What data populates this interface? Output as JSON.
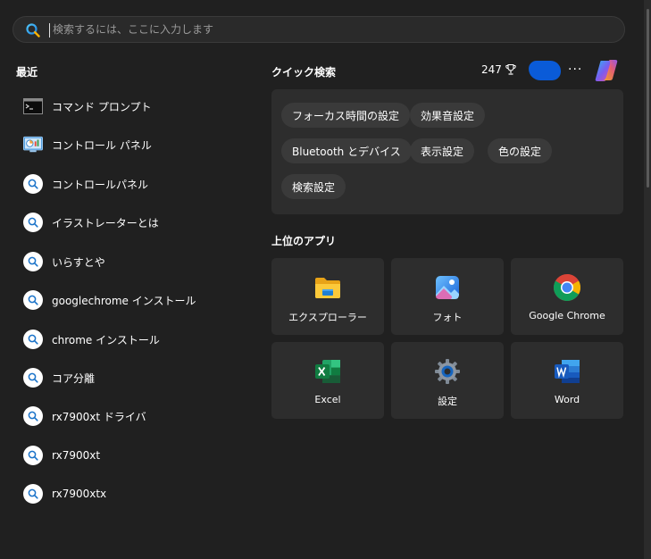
{
  "search": {
    "placeholder": "検索するには、ここに入力します"
  },
  "recent": {
    "title": "最近",
    "items": [
      {
        "label": "コマンド プロンプト",
        "icon": "command-prompt-icon"
      },
      {
        "label": "コントロール パネル",
        "icon": "control-panel-icon"
      },
      {
        "label": "コントロールパネル",
        "icon": "web-search-icon"
      },
      {
        "label": "イラストレーターとは",
        "icon": "web-search-icon"
      },
      {
        "label": "いらすとや",
        "icon": "web-search-icon"
      },
      {
        "label": "googlechrome インストール",
        "icon": "web-search-icon"
      },
      {
        "label": "chrome インストール",
        "icon": "web-search-icon"
      },
      {
        "label": "コア分離",
        "icon": "web-search-icon"
      },
      {
        "label": "rx7900xt ドライバ",
        "icon": "web-search-icon"
      },
      {
        "label": "rx7900xt",
        "icon": "web-search-icon"
      },
      {
        "label": "rx7900xtx",
        "icon": "web-search-icon"
      }
    ]
  },
  "header": {
    "quick_search_title": "クイック検索",
    "points": "247",
    "more": "···"
  },
  "quick_search": {
    "chips": [
      "フォーカス時間の設定",
      "効果音設定",
      "Bluetooth とデバイス",
      "表示設定",
      "色の設定",
      "検索設定"
    ]
  },
  "top_apps": {
    "title": "上位のアプリ",
    "apps": [
      {
        "label": "エクスプローラー",
        "icon": "file-explorer-icon"
      },
      {
        "label": "フォト",
        "icon": "photos-icon"
      },
      {
        "label": "Google Chrome",
        "icon": "chrome-icon"
      },
      {
        "label": "Excel",
        "icon": "excel-icon"
      },
      {
        "label": "設定",
        "icon": "settings-gear-icon"
      },
      {
        "label": "Word",
        "icon": "word-icon"
      }
    ]
  },
  "colors": {
    "background": "#202020",
    "panel": "#2d2d2d",
    "chip": "#3a3a3a",
    "accent_blue": "#0a5bd8"
  }
}
